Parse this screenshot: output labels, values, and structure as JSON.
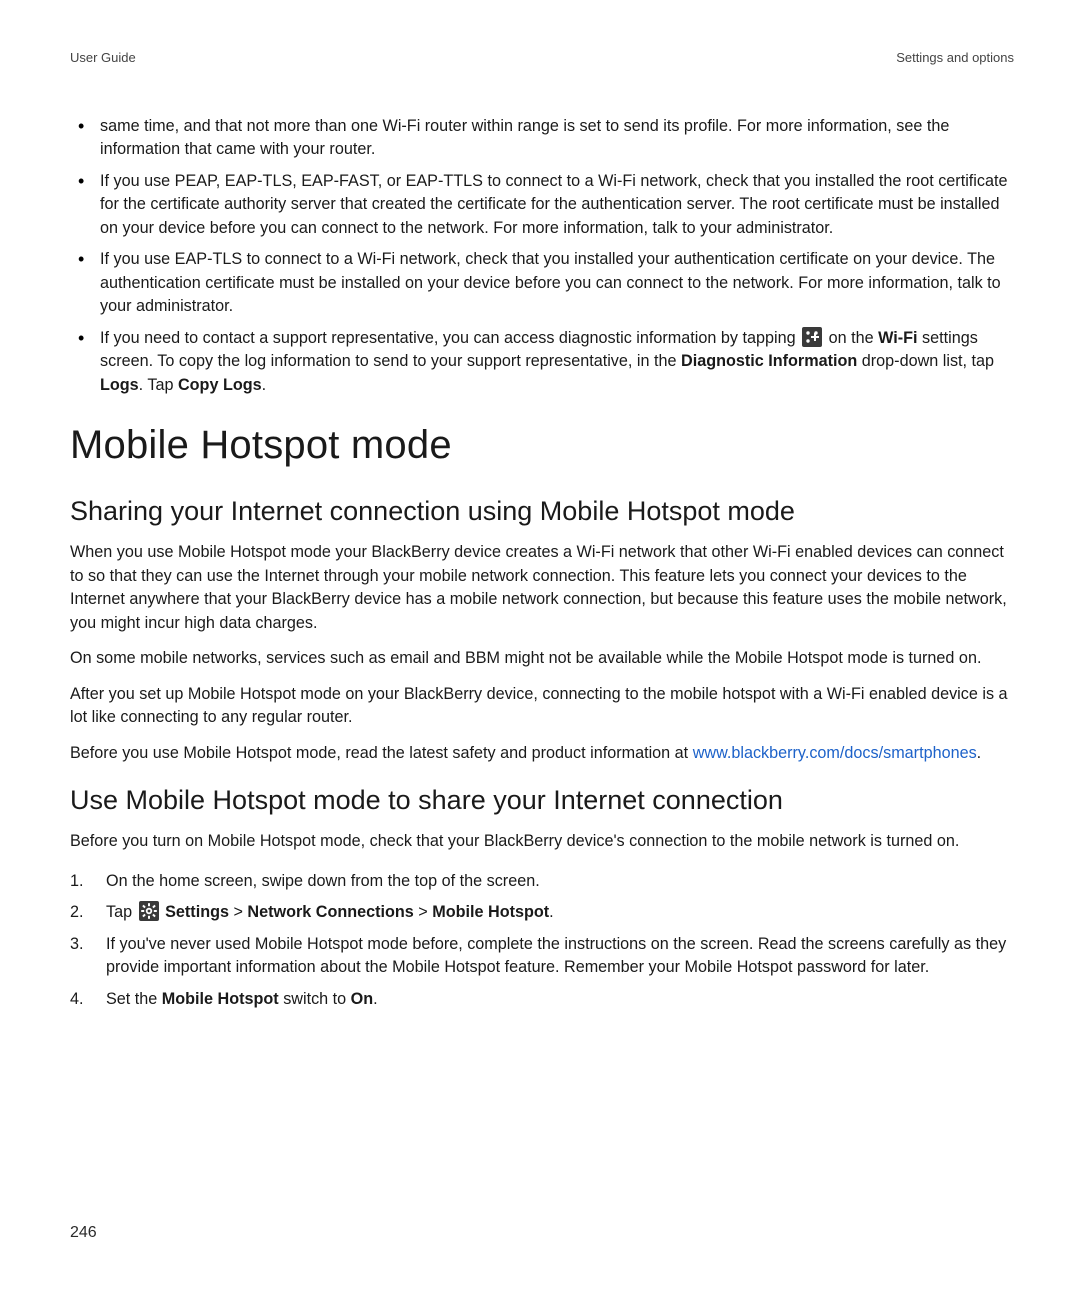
{
  "header": {
    "left": "User Guide",
    "right": "Settings and options"
  },
  "bullets": [
    {
      "html": "same time, and that not more than one Wi-Fi router within range is set to send its profile. For more information, see the information that came with your router."
    },
    {
      "html": "If you use PEAP, EAP-TLS, EAP-FAST, or EAP-TTLS to connect to a Wi-Fi network, check that you installed the root certificate for the certificate authority server that created the certificate for the authentication server. The root certificate must be installed on your device before you can connect to the network. For more information, talk to your administrator."
    },
    {
      "html": "If you use EAP-TLS to connect to a Wi-Fi network, check that you installed your authentication certificate on your device. The authentication certificate must be installed on your device before you can connect to the network. For more information, talk to your administrator."
    },
    {
      "html": "If you need to contact a support representative, you can access diagnostic information by tapping {{OVERFLOW_ICON}} on the <b>Wi-Fi</b> settings screen. To copy the log information to send to your support representative, in the <b>Diagnostic Information</b> drop-down list, tap <b>Logs</b>. Tap <b>Copy Logs</b>."
    }
  ],
  "title": "Mobile Hotspot mode",
  "sectionA": {
    "heading": "Sharing your Internet connection using Mobile Hotspot mode",
    "paragraphs": [
      "When you use Mobile Hotspot mode your BlackBerry device creates a Wi-Fi network that other Wi-Fi enabled devices can connect to so that they can use the Internet through your mobile network connection. This feature lets you connect your devices to the Internet anywhere that your BlackBerry device has a mobile network connection, but because this feature uses the mobile network, you might incur high data charges.",
      "On some mobile networks, services such as email and BBM might not be available while the Mobile Hotspot mode is turned on.",
      "After you set up Mobile Hotspot mode on your BlackBerry device, connecting to the mobile hotspot with a Wi-Fi enabled device is a lot like connecting to any regular router."
    ],
    "link_paragraph": {
      "before": "Before you use Mobile Hotspot mode, read the latest safety and product information at ",
      "link_text": "www.blackberry.com/docs/smartphones",
      "after": "."
    }
  },
  "sectionB": {
    "heading": "Use Mobile Hotspot mode to share your Internet connection",
    "intro": "Before you turn on Mobile Hotspot mode, check that your BlackBerry device's connection to the mobile network is turned on.",
    "steps": [
      {
        "html": "On the home screen, swipe down from the top of the screen."
      },
      {
        "html": "Tap {{SETTINGS_ICON}} <b>Settings</b> > <b>Network Connections</b> > <b>Mobile Hotspot</b>."
      },
      {
        "html": "If you've never used Mobile Hotspot mode before, complete the instructions on the screen. Read the screens carefully as they provide important information about the Mobile Hotspot feature. Remember your Mobile Hotspot password for later."
      },
      {
        "html": "Set the <b>Mobile Hotspot</b> switch to <b>On</b>."
      }
    ]
  },
  "page_number": "246",
  "icons": {
    "overflow_svg": "<svg class='icon-inline' viewBox='0 0 20 20' data-name='overflow-menu-icon' data-interactable='false'><rect x='0' y='0' width='20' height='20' rx='2' fill='#3a3a3a'/><circle cx='6' cy='6' r='1.7' fill='#fff'/><circle cx='6' cy='14' r='1.7' fill='#fff'/><circle cx='14' cy='6' r='1.7' fill='#fff'/><rect x='9' y='9' width='8' height='2' fill='#fff'/><rect x='12' y='6' width='2' height='8' fill='#fff'/></svg>",
    "settings_svg": "<svg class='icon-inline' viewBox='0 0 20 20' data-name='settings-gear-icon' data-interactable='false'><rect x='0' y='0' width='20' height='20' rx='2' fill='#3a3a3a'/><g fill='#fff'><circle cx='10' cy='10' r='3.2'/><rect x='9' y='2.2' width='2' height='3'/><rect x='9' y='14.8' width='2' height='3'/><rect x='2.2' y='9' width='3' height='2'/><rect x='14.8' y='9' width='3' height='2'/><rect x='4' y='4' width='2' height='3' transform='rotate(-45 5 5.5)'/><rect x='14' y='13' width='2' height='3' transform='rotate(-45 15 14.5)'/><rect x='4' y='13' width='2' height='3' transform='rotate(45 5 14.5)'/><rect x='14' y='4' width='2' height='3' transform='rotate(45 15 5.5)'/></g><circle cx='10' cy='10' r='1.4' fill='#3a3a3a'/></svg>"
  }
}
